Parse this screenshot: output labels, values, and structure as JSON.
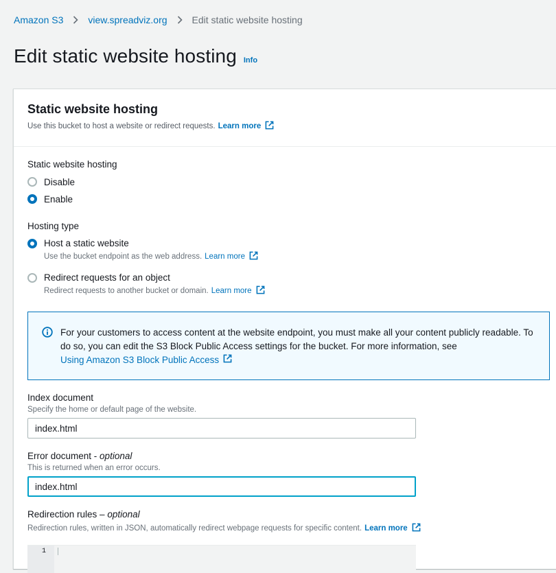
{
  "breadcrumb": {
    "items": [
      "Amazon S3",
      "view.spreadviz.org"
    ],
    "current": "Edit static website hosting"
  },
  "header": {
    "title": "Edit static website hosting",
    "info": "Info"
  },
  "panel": {
    "title": "Static website hosting",
    "description": "Use this bucket to host a website or redirect requests.",
    "learn_more": "Learn more"
  },
  "hosting": {
    "label": "Static website hosting",
    "options": [
      "Disable",
      "Enable"
    ],
    "selected": "Enable"
  },
  "hosting_type": {
    "label": "Hosting type",
    "options": [
      {
        "label": "Host a static website",
        "desc": "Use the bucket endpoint as the web address.",
        "learn_more": "Learn more"
      },
      {
        "label": "Redirect requests for an object",
        "desc": "Redirect requests to another bucket or domain.",
        "learn_more": "Learn more"
      }
    ],
    "selected": "Host a static website"
  },
  "alert": {
    "text": "For your customers to access content at the website endpoint, you must make all your content publicly readable. To do so, you can edit the S3 Block Public Access settings for the bucket. For more information, see",
    "link": "Using Amazon S3 Block Public Access"
  },
  "index_document": {
    "label": "Index document",
    "description": "Specify the home or default page of the website.",
    "value": "index.html"
  },
  "error_document": {
    "label": "Error document",
    "optional": "optional",
    "description": "This is returned when an error occurs.",
    "value": "index.html"
  },
  "redirection_rules": {
    "label": "Redirection rules",
    "optional": "optional",
    "description": "Redirection rules, written in JSON, automatically redirect webpage requests for specific content.",
    "learn_more": "Learn more",
    "line_number": "1"
  },
  "colors": {
    "link": "#0073bb",
    "radio_checked": "#0073bb",
    "alert_bg": "#f1faff",
    "focus_border": "#00a1c9"
  },
  "icons": {
    "breadcrumb_separator": "chevron-right-icon",
    "external": "external-link-icon",
    "alert": "info-circle-icon"
  }
}
